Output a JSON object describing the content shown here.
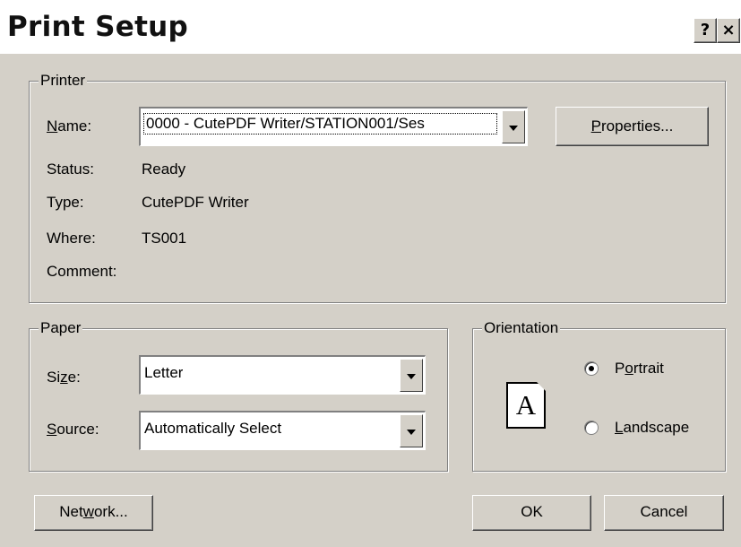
{
  "window": {
    "title": "Print Setup",
    "help_button": "?",
    "close_button": "×"
  },
  "printer": {
    "group_label": "Printer",
    "name_label": "Name:",
    "name_value": "0000 - CutePDF Writer/STATION001/Ses",
    "properties_button": "Properties...",
    "status_label": "Status:",
    "status_value": "Ready",
    "type_label": "Type:",
    "type_value": "CutePDF Writer",
    "where_label": "Where:",
    "where_value": "TS001",
    "comment_label": "Comment:",
    "comment_value": ""
  },
  "paper": {
    "group_label": "Paper",
    "size_label": "Size:",
    "size_value": "Letter",
    "source_label": "Source:",
    "source_value": "Automatically Select"
  },
  "orientation": {
    "group_label": "Orientation",
    "icon_letter": "A",
    "portrait_label": "Portrait",
    "landscape_label": "Landscape",
    "selected": "Portrait"
  },
  "footer": {
    "network_button": "Network...",
    "ok_button": "OK",
    "cancel_button": "Cancel"
  }
}
